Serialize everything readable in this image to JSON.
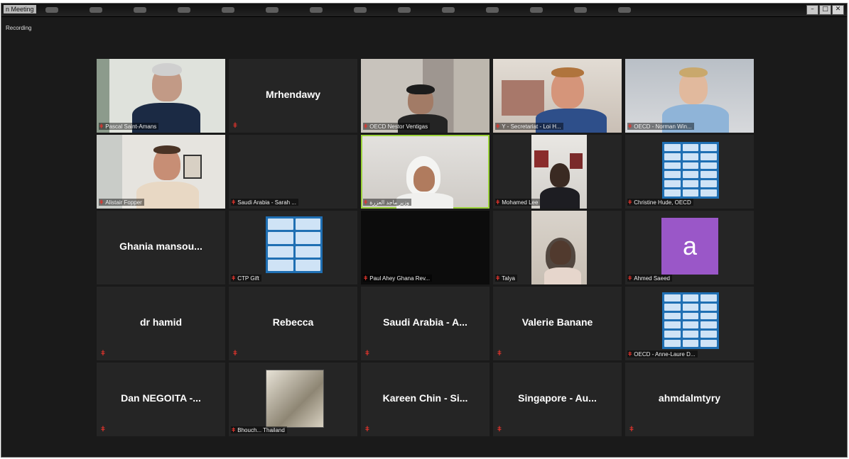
{
  "window": {
    "title": "n Meeting",
    "recording_label": "Recording",
    "controls": [
      "–",
      "□",
      "✕"
    ]
  },
  "participants": [
    {
      "name": "Pascal Saint-Amans"
    },
    {
      "name": "Mrhendawy"
    },
    {
      "name": "OECD Nestor Ventigas"
    },
    {
      "name": "Y - Secretariat - Loi H..."
    },
    {
      "name": "OECD - Norman Win..."
    },
    {
      "name": "Alistair Fopper"
    },
    {
      "name": "Saudi Arabia - Sarah ..."
    },
    {
      "name": "وزير ماجد العزرة"
    },
    {
      "name": "Mohamed Lee"
    },
    {
      "name": "Christine Hude, OECD"
    },
    {
      "name": "Ghania mansou..."
    },
    {
      "name": "CTP Gift"
    },
    {
      "name": "Paul Ahey Ghana Rev..."
    },
    {
      "name": "Talya"
    },
    {
      "name": "Ahmed Saeed",
      "avatar_letter": "a"
    },
    {
      "name": "dr hamid"
    },
    {
      "name": "Rebecca"
    },
    {
      "name": "Saudi Arabia - A..."
    },
    {
      "name": "Valerie Banane"
    },
    {
      "name": "OECD - Anne-Laure D..."
    },
    {
      "name": "Dan NEGOITA -..."
    },
    {
      "name": "Bhouch... Thailand"
    },
    {
      "name": "Kareen Chin - Si..."
    },
    {
      "name": "Singapore - Au..."
    },
    {
      "name": "ahmdalmtyry"
    }
  ],
  "colors": {
    "active_speaker": "#9bd23a",
    "muted_mic": "#e0342c",
    "avatar": "#9a57c8",
    "oecd_blue": "#1f6fb3"
  },
  "icons": {
    "muted": "muted-mic-icon"
  }
}
